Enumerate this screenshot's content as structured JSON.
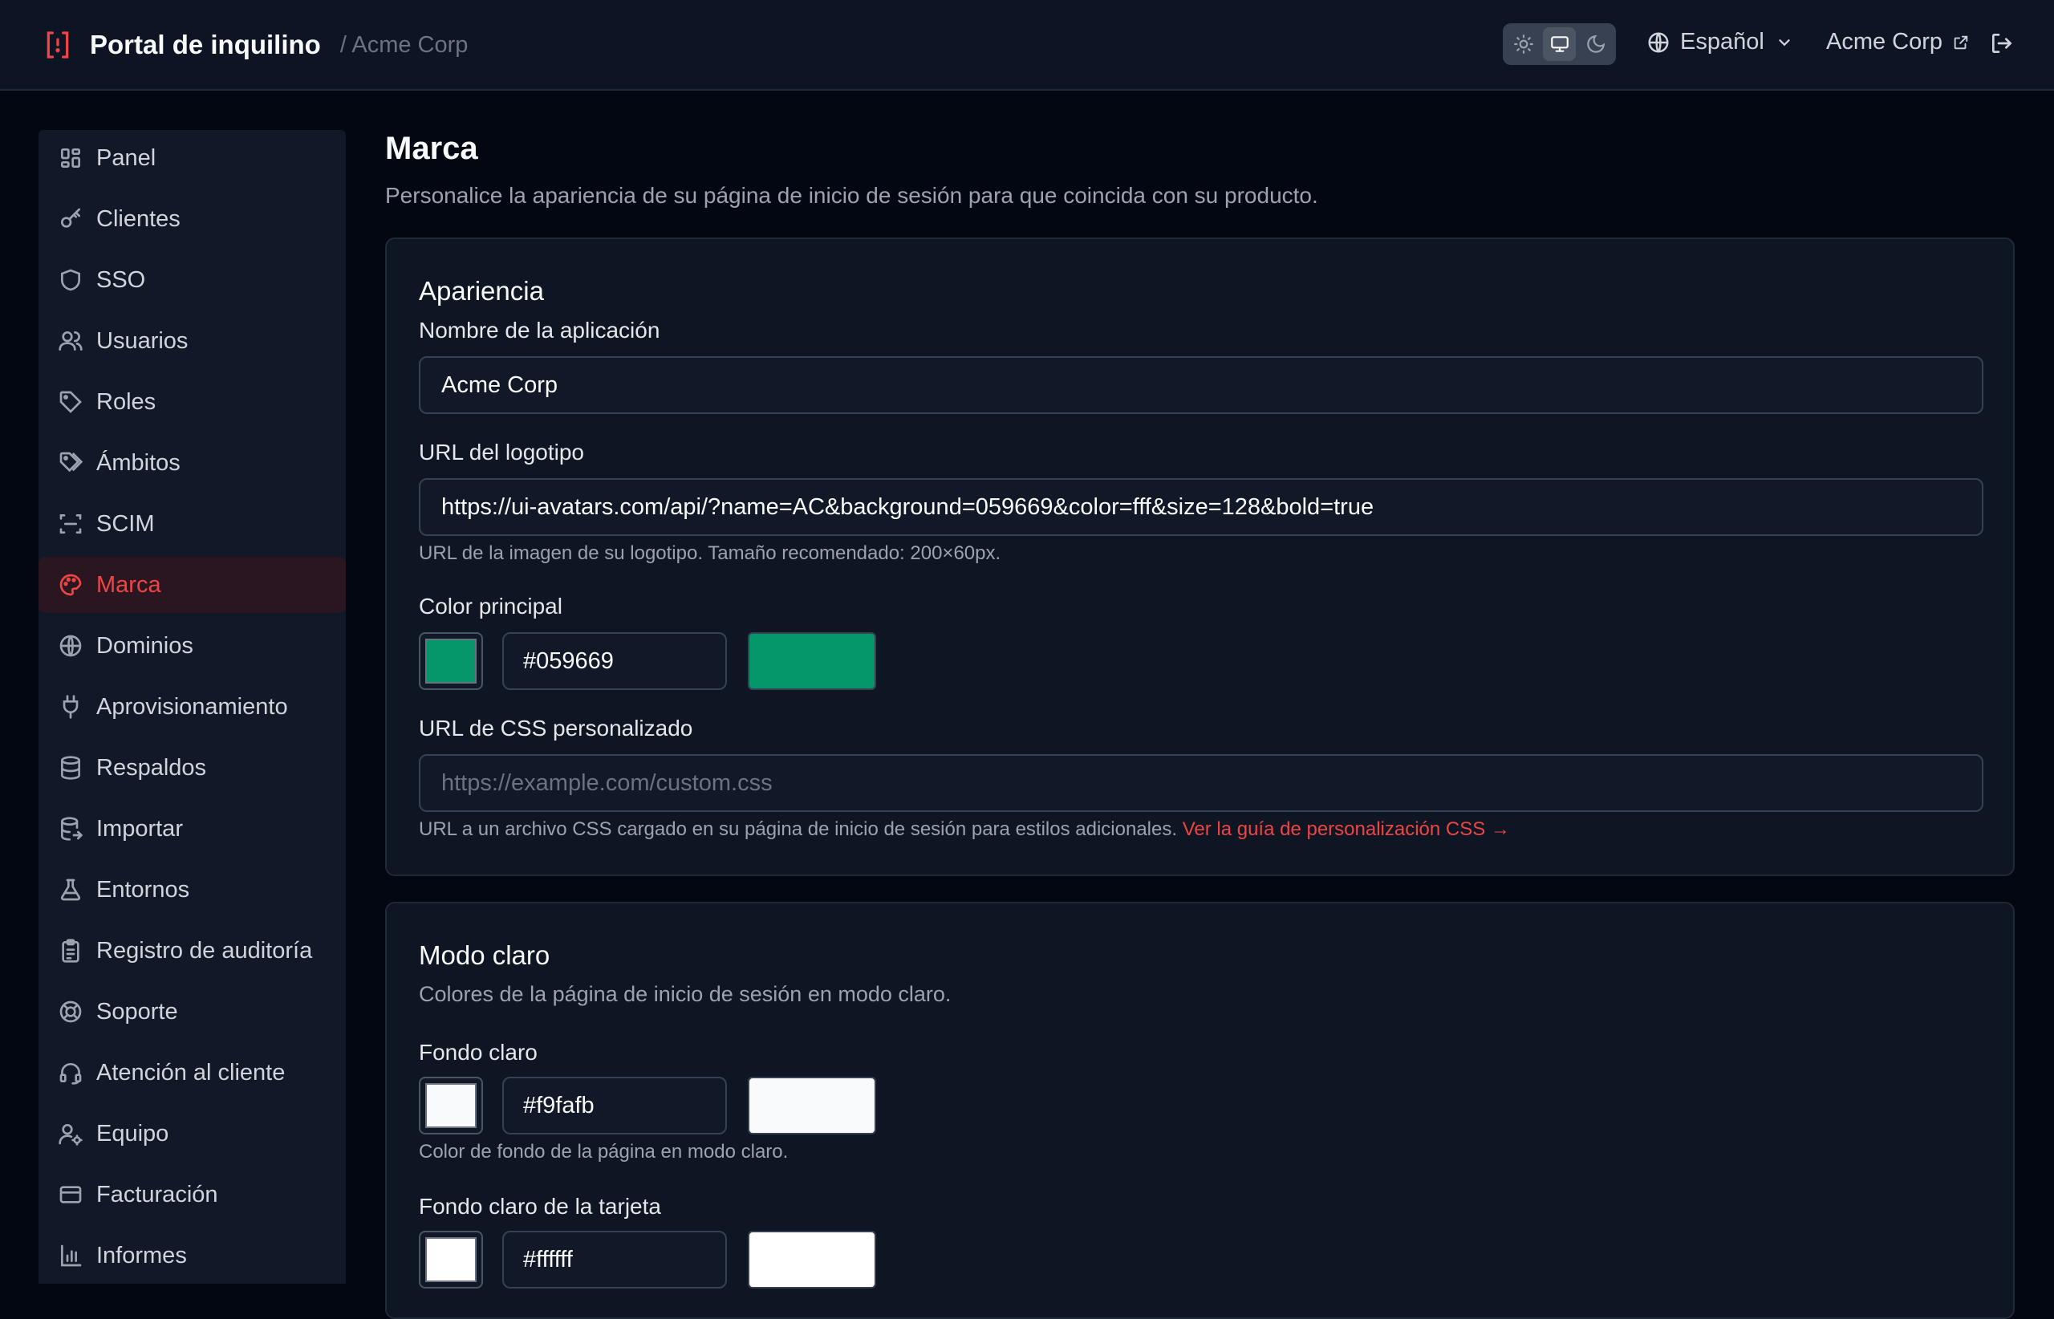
{
  "header": {
    "title": "Portal de inquilino",
    "breadcrumb": "/ Acme Corp",
    "language": "Español",
    "tenant_link": "Acme Corp",
    "theme_options": [
      "light",
      "system",
      "dark"
    ],
    "theme_selected": "system"
  },
  "sidebar": {
    "active": "Marca",
    "items": [
      {
        "label": "Panel",
        "icon": "dashboard-icon"
      },
      {
        "label": "Clientes",
        "icon": "key-icon"
      },
      {
        "label": "SSO",
        "icon": "shield-icon"
      },
      {
        "label": "Usuarios",
        "icon": "users-icon"
      },
      {
        "label": "Roles",
        "icon": "tag-icon"
      },
      {
        "label": "Ámbitos",
        "icon": "tags-icon"
      },
      {
        "label": "SCIM",
        "icon": "scan-icon"
      },
      {
        "label": "Marca",
        "icon": "palette-icon"
      },
      {
        "label": "Dominios",
        "icon": "globe-icon"
      },
      {
        "label": "Aprovisionamiento",
        "icon": "plug-icon"
      },
      {
        "label": "Respaldos",
        "icon": "database-icon"
      },
      {
        "label": "Importar",
        "icon": "database-import-icon"
      },
      {
        "label": "Entornos",
        "icon": "flask-icon"
      },
      {
        "label": "Registro de auditoría",
        "icon": "clipboard-icon"
      },
      {
        "label": "Soporte",
        "icon": "lifebuoy-icon"
      },
      {
        "label": "Atención al cliente",
        "icon": "headset-icon"
      },
      {
        "label": "Equipo",
        "icon": "user-cog-icon"
      },
      {
        "label": "Facturación",
        "icon": "credit-card-icon"
      },
      {
        "label": "Informes",
        "icon": "bar-chart-icon"
      }
    ]
  },
  "page": {
    "title": "Marca",
    "subtitle": "Personalice la apariencia de su página de inicio de sesión para que coincida con su producto."
  },
  "appearance": {
    "title": "Apariencia",
    "app_name_label": "Nombre de la aplicación",
    "app_name_value": "Acme Corp",
    "logo_label": "URL del logotipo",
    "logo_value": "https://ui-avatars.com/api/?name=AC&background=059669&color=fff&size=128&bold=true",
    "logo_help": "URL de la imagen de su logotipo. Tamaño recomendado: 200×60px.",
    "primary_label": "Color principal",
    "primary_value": "#059669",
    "primary_color": "#059669",
    "css_label": "URL de CSS personalizado",
    "css_placeholder": "https://example.com/custom.css",
    "css_help": "URL a un archivo CSS cargado en su página de inicio de sesión para estilos adicionales.",
    "css_help_link": "Ver la guía de personalización CSS →"
  },
  "light_mode": {
    "title": "Modo claro",
    "description": "Colores de la página de inicio de sesión en modo claro.",
    "bg_label": "Fondo claro",
    "bg_value": "#f9fafb",
    "bg_color": "#f9fafb",
    "bg_help": "Color de fondo de la página en modo claro.",
    "card_label": "Fondo claro de la tarjeta",
    "card_value": "#ffffff",
    "card_color": "#ffffff"
  }
}
